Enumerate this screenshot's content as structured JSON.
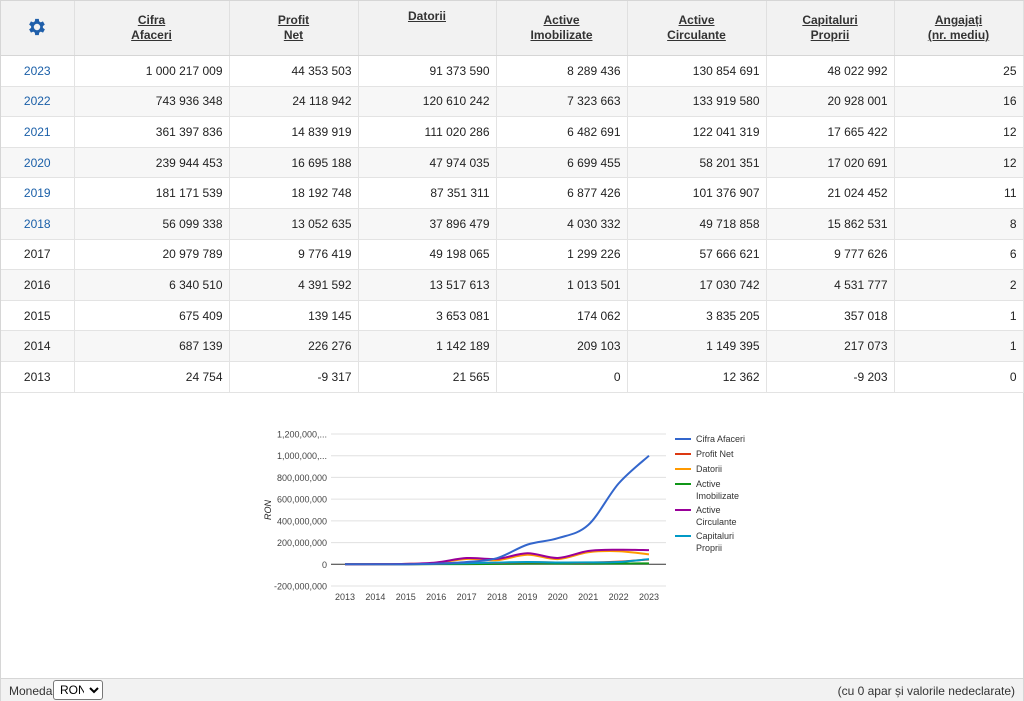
{
  "table": {
    "headers": [
      {
        "l1": "",
        "l2": ""
      },
      {
        "l1": "Cifra",
        "l2": "Afaceri"
      },
      {
        "l1": "Profit",
        "l2": "Net"
      },
      {
        "l1": "Datorii",
        "l2": ""
      },
      {
        "l1": "Active",
        "l2": "Imobilizate"
      },
      {
        "l1": "Active",
        "l2": "Circulante"
      },
      {
        "l1": "Capitaluri",
        "l2": "Proprii"
      },
      {
        "l1": "Angajați",
        "l2": "(nr. mediu)"
      }
    ],
    "rows": [
      [
        "2023",
        "1 000 217 009",
        "44 353 503",
        "91 373 590",
        "8 289 436",
        "130 854 691",
        "48 022 992",
        "25"
      ],
      [
        "2022",
        "743 936 348",
        "24 118 942",
        "120 610 242",
        "7 323 663",
        "133 919 580",
        "20 928 001",
        "16"
      ],
      [
        "2021",
        "361 397 836",
        "14 839 919",
        "111 020 286",
        "6 482 691",
        "122 041 319",
        "17 665 422",
        "12"
      ],
      [
        "2020",
        "239 944 453",
        "16 695 188",
        "47 974 035",
        "6 699 455",
        "58 201 351",
        "17 020 691",
        "12"
      ],
      [
        "2019",
        "181 171 539",
        "18 192 748",
        "87 351 311",
        "6 877 426",
        "101 376 907",
        "21 024 452",
        "11"
      ],
      [
        "2018",
        "56 099 338",
        "13 052 635",
        "37 896 479",
        "4 030 332",
        "49 718 858",
        "15 862 531",
        "8"
      ],
      [
        "2017",
        "20 979 789",
        "9 776 419",
        "49 198 065",
        "1 299 226",
        "57 666 621",
        "9 777 626",
        "6"
      ],
      [
        "2016",
        "6 340 510",
        "4 391 592",
        "13 517 613",
        "1 013 501",
        "17 030 742",
        "4 531 777",
        "2"
      ],
      [
        "2015",
        "675 409",
        "139 145",
        "3 653 081",
        "174 062",
        "3 835 205",
        "357 018",
        "1"
      ],
      [
        "2014",
        "687 139",
        "226 276",
        "1 142 189",
        "209 103",
        "1 149 395",
        "217 073",
        "1"
      ],
      [
        "2013",
        "24 754",
        "-9 317",
        "21 565",
        "0",
        "12 362",
        "-9 203",
        "0"
      ]
    ],
    "linked_years": [
      "2023",
      "2022",
      "2021",
      "2020",
      "2019",
      "2018"
    ]
  },
  "chart_data": {
    "type": "line",
    "ylabel": "RON",
    "y_ticks": [
      "1,200,000,...",
      "1,000,000,...",
      "800,000,000",
      "600,000,000",
      "400,000,000",
      "200,000,000",
      "0",
      "-200,000,000"
    ],
    "ylim": [
      -200000000,
      1200000000
    ],
    "x": [
      "2013",
      "2014",
      "2015",
      "2016",
      "2017",
      "2018",
      "2019",
      "2020",
      "2021",
      "2022",
      "2023"
    ],
    "series": [
      {
        "name": "Cifra Afaceri",
        "color": "#3366cc",
        "values": [
          24754,
          687139,
          675409,
          6340510,
          20979789,
          56099338,
          181171539,
          239944453,
          361397836,
          743936348,
          1000217009
        ]
      },
      {
        "name": "Profit Net",
        "color": "#dc3912",
        "values": [
          -9317,
          226276,
          139145,
          4391592,
          9776419,
          13052635,
          18192748,
          16695188,
          14839919,
          24118942,
          44353503
        ]
      },
      {
        "name": "Datorii",
        "color": "#ff9900",
        "values": [
          21565,
          1142189,
          3653081,
          13517613,
          49198065,
          37896479,
          87351311,
          47974035,
          111020286,
          120610242,
          91373590
        ]
      },
      {
        "name": "Active Imobilizate",
        "color": "#109618",
        "values": [
          0,
          209103,
          174062,
          1013501,
          1299226,
          4030332,
          6877426,
          6699455,
          6482691,
          7323663,
          8289436
        ]
      },
      {
        "name": "Active Circulante",
        "color": "#990099",
        "values": [
          12362,
          1149395,
          3835205,
          17030742,
          57666621,
          49718858,
          101376907,
          58201351,
          122041319,
          133919580,
          130854691
        ]
      },
      {
        "name": "Capitaluri Proprii",
        "color": "#0099c6",
        "values": [
          -9203,
          217073,
          357018,
          4531777,
          9777626,
          15862531,
          21024452,
          17020691,
          17665422,
          20928001,
          48022992
        ]
      }
    ],
    "legend_labels": [
      [
        "Cifra Afaceri"
      ],
      [
        "Profit Net"
      ],
      [
        "Datorii"
      ],
      [
        "Active",
        "Imobilizate"
      ],
      [
        "Active",
        "Circulante"
      ],
      [
        "Capitaluri",
        "Proprii"
      ]
    ],
    "legend_position": "right",
    "grid": true
  },
  "footer": {
    "currency_label": "Moneda",
    "currency_selected": "RON",
    "note": "(cu 0 apar și valorile nedeclarate)"
  },
  "icons": {
    "settings": "gear-icon"
  }
}
